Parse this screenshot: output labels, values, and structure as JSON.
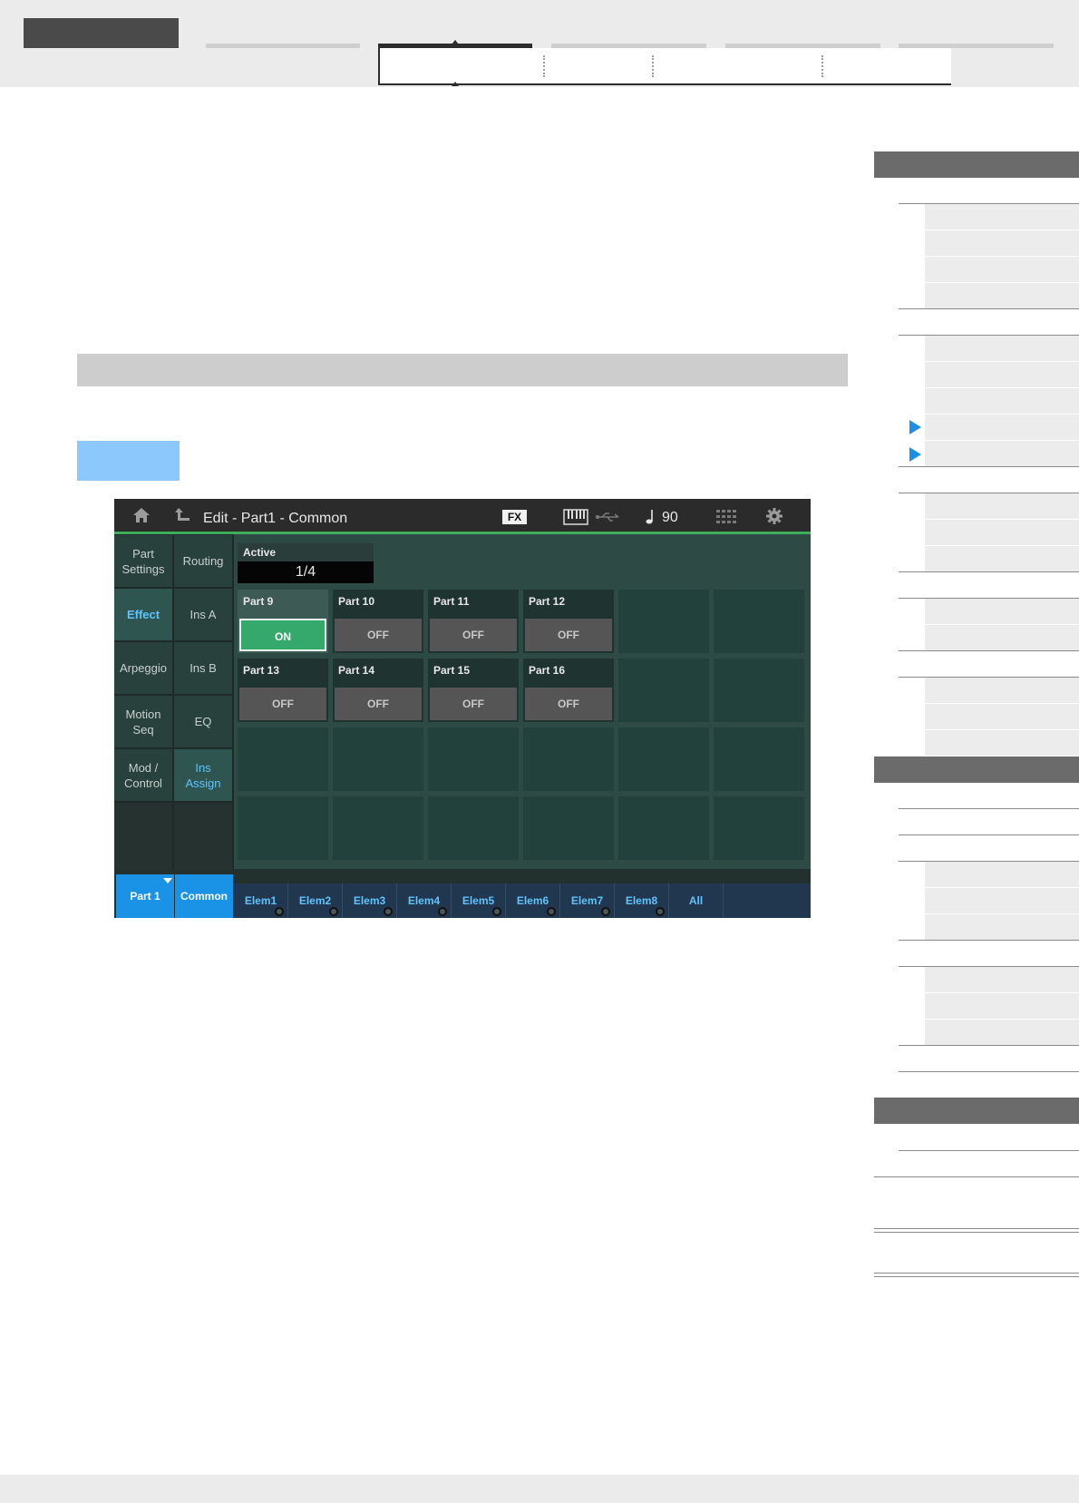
{
  "screen": {
    "title": "Edit - Part1 - Common",
    "fx_badge": "FX",
    "tempo": "90",
    "tempo_icon": "quarter-note-icon",
    "left_tabs_col1": [
      "Part\nSettings",
      "Effect",
      "Arpeggio",
      "Motion\nSeq",
      "Mod /\nControl",
      ""
    ],
    "left_tabs_col2": [
      "Routing",
      "Ins A",
      "Ins B",
      "EQ",
      "Ins\nAssign",
      ""
    ],
    "active": {
      "label": "Active",
      "value": "1/4"
    },
    "parts": [
      {
        "name": "Part 9",
        "state": "ON"
      },
      {
        "name": "Part 10",
        "state": "OFF"
      },
      {
        "name": "Part 11",
        "state": "OFF"
      },
      {
        "name": "Part 12",
        "state": "OFF"
      },
      {
        "name": "Part 13",
        "state": "OFF"
      },
      {
        "name": "Part 14",
        "state": "OFF"
      },
      {
        "name": "Part 15",
        "state": "OFF"
      },
      {
        "name": "Part 16",
        "state": "OFF"
      }
    ],
    "footer": {
      "part": "Part 1",
      "common": "Common",
      "elements": [
        "Elem1",
        "Elem2",
        "Elem3",
        "Elem4",
        "Elem5",
        "Elem6",
        "Elem7",
        "Elem8",
        "All"
      ]
    }
  },
  "colors": {
    "accent_blue": "#1a92e6",
    "on_green": "#35a86b",
    "nav_arrow": "#1a8fe3"
  }
}
